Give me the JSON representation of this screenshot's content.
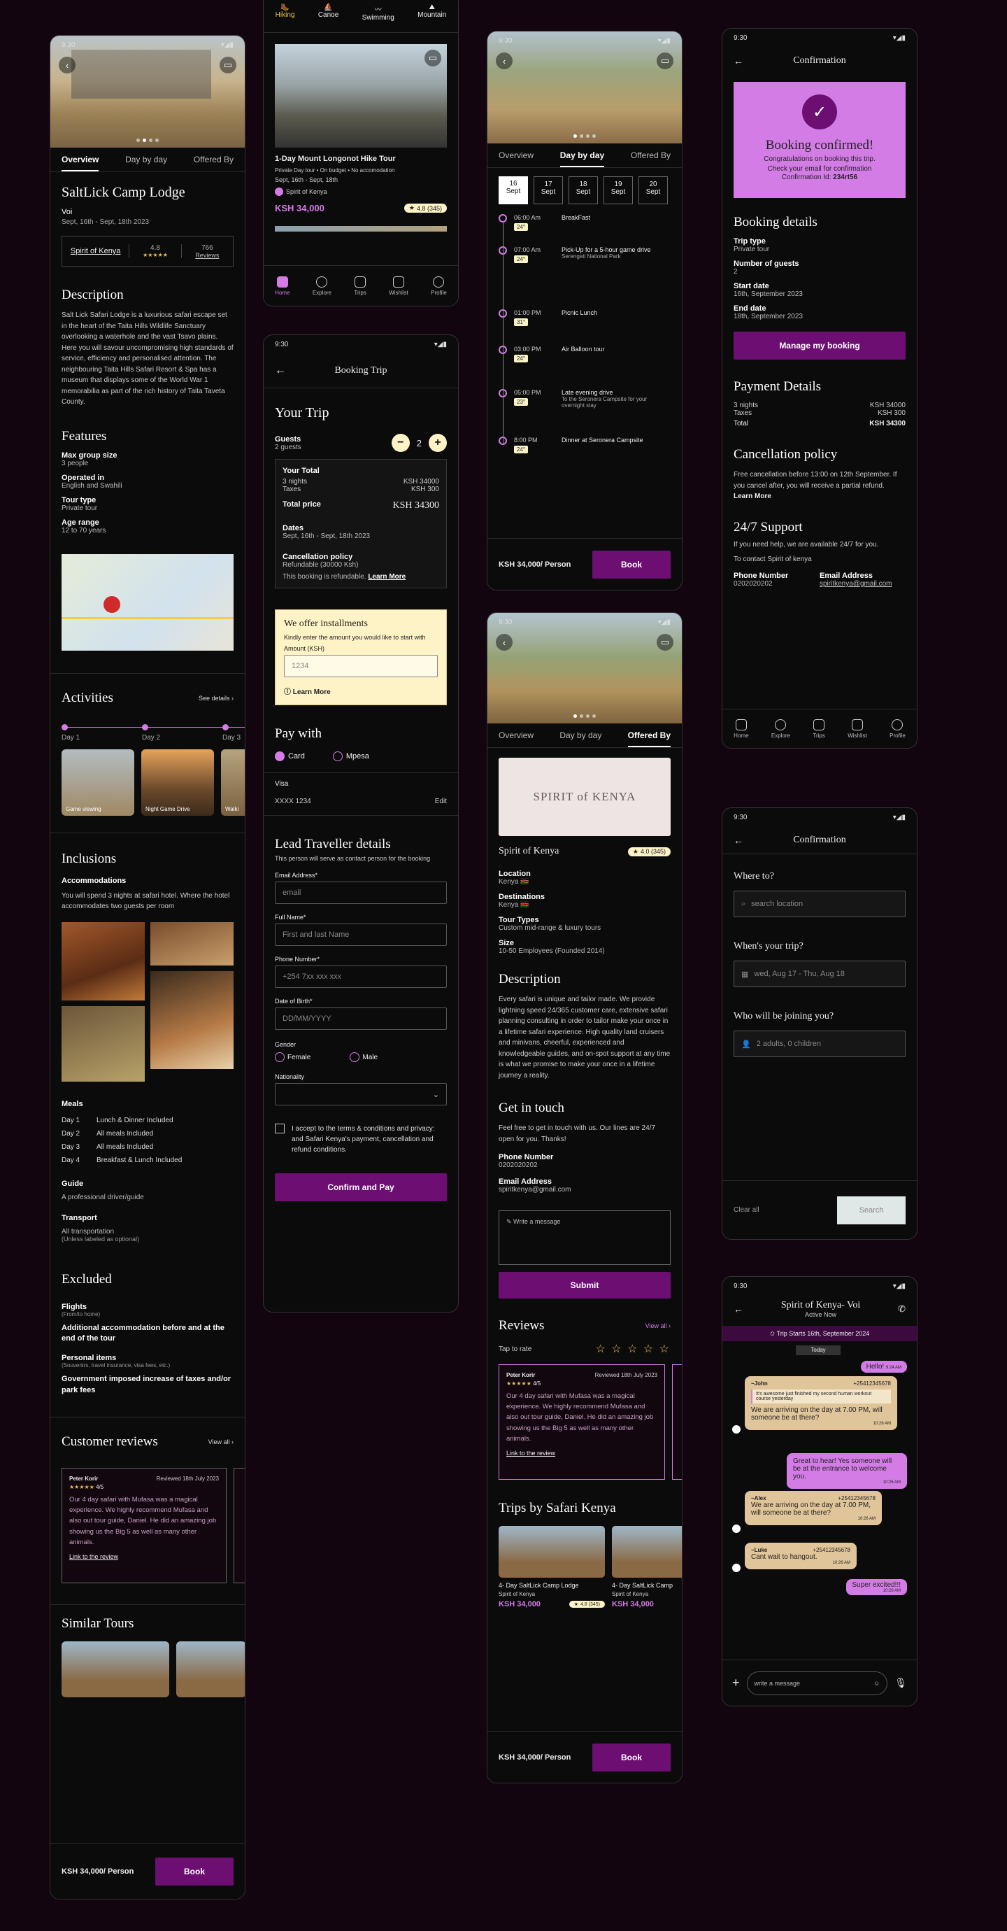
{
  "status_time": "9:30",
  "lodge": {
    "tabs": [
      "Overview",
      "Day by day",
      "Offered By"
    ],
    "title": "SaltLick Camp Lodge",
    "subtitle": "Voi",
    "dates": "Sept, 16th - Sept, 18th 2023",
    "operator": "Spirit of Kenya",
    "rating": "4.8",
    "stars": "★★★★★",
    "reviews_count": "766",
    "reviews_label": "Reviews",
    "description_title": "Description",
    "description": "Salt Lick Safari Lodge is a luxurious safari escape set in the heart of the Taita Hills Wildlife Sanctuary overlooking a waterhole and the vast Tsavo plains. Here you will savour uncompromising high standards of service, efficiency and personalised attention. The neighbouring Taita Hills Safari Resort & Spa has a museum that displays some of the World War 1 memorabilia as part of the rich history of Taita Taveta County.",
    "features_title": "Features",
    "features": [
      {
        "label": "Max group size",
        "value": "3 people"
      },
      {
        "label": "Operated in",
        "value": "English and Swahili"
      },
      {
        "label": "Tour type",
        "value": "Private tour"
      },
      {
        "label": "Age range",
        "value": "12 to 70 years"
      }
    ],
    "activities_title": "Activities",
    "see_details": "See details ›",
    "days": [
      "Day 1",
      "Day 2",
      "Day 3"
    ],
    "activities": [
      "Game viewing",
      "Night Game Drive",
      "Walki"
    ],
    "inclusions_title": "Inclusions",
    "accom_title": "Accommodations",
    "accom_text": "You will spend 3 nights at safari hotel. Where the hotel accommodates two guests per room",
    "meals_title": "Meals",
    "meals": [
      {
        "day": "Day 1",
        "text": "Lunch & Dinner Included"
      },
      {
        "day": "Day 2",
        "text": "All meals Included"
      },
      {
        "day": "Day 3",
        "text": "All meals Included"
      },
      {
        "day": "Day 4",
        "text": "Breakfast & Lunch Included"
      }
    ],
    "guide_title": "Guide",
    "guide_text": "A professional driver/guide",
    "transport_title": "Transport",
    "transport_text": "All transportation",
    "transport_note": "(Unless labeled as optional)",
    "excluded_title": "Excluded",
    "flights_title": "Flights",
    "flights_note": "(From/to home)",
    "excl1": "Additional accommodation before and at the end of the tour",
    "personal_title": "Personal items",
    "personal_note": "(Souvenirs, travel insurance, visa fees, etc.)",
    "excl2": "Government imposed increase of taxes and/or park fees",
    "cr_title": "Customer reviews",
    "view_all": "View all ›",
    "similar_title": "Similar Tours",
    "price": "KSH 34,000/ Person",
    "book": "Book"
  },
  "review": {
    "name": "Peter Korir",
    "date": "Reviewed 18th July 2023",
    "stars": "★★★★★",
    "score": "4/5",
    "text": "Our 4 day safari with Mufasa was a magical experience. We highly recommend Mufasa and also out tour guide, Daniel. He did an amazing job showing us the Big 5 as well as many other animals.",
    "link": "Link to the review"
  },
  "explore": {
    "categories": [
      "Hiking",
      "Canoe",
      "Swimming",
      "Mountain"
    ],
    "card_title": "1-Day Mount Longonot Hike Tour",
    "card_meta": "Private Day tour  •  On budget  •  No accomodation",
    "card_dates": "Sept, 16th - Sept, 18th",
    "operator": "Spirit of Kenya",
    "price": "KSH 34,000",
    "rating": "4.8 (345)",
    "nav": [
      "Home",
      "Explore",
      "Trips",
      "Wishlist",
      "Profile"
    ]
  },
  "booking": {
    "header": "Booking Trip",
    "your_trip": "Your Trip",
    "guests_label": "Guests",
    "guests_sub": "2 guests",
    "guests_count": "2",
    "total_title": "Your Total",
    "nights": "3 nights",
    "nights_val": "KSH 34000",
    "taxes": "Taxes",
    "taxes_val": "KSH 300",
    "total_price": "Total price",
    "total_val": "KSH 34300",
    "dates_label": "Dates",
    "dates_val": "Sept, 16th - Sept, 18th 2023",
    "cancel_label": "Cancellation policy",
    "cancel_val": "Refundable (30000 Ksh)",
    "refund_text": "This booking is refundable.",
    "learn_more": "Learn More",
    "inst_title": "We offer installments",
    "inst_text": "Kindly enter the amount you would like to start with",
    "amount_label": "Amount (KSH)",
    "amount_ph": "1234",
    "inst_learn": "ⓘ Learn More",
    "paywith": "Pay with",
    "card": "Card",
    "mpesa": "Mpesa",
    "visa": "Visa",
    "visa_num": "XXXX 1234",
    "edit": "Edit",
    "lead_title": "Lead Traveller details",
    "lead_sub": "This person will serve as contact person for the  booking",
    "email_label": "Email Address*",
    "email_ph": "email",
    "name_label": "Full Name*",
    "name_ph": "First and last Name",
    "phone_label": "Phone Number*",
    "phone_ph": "+254 7xx xxx xxx",
    "dob_label": "Date  of Birth*",
    "dob_ph": "DD/MM/YYYY",
    "gender_label": "Gender",
    "female": "Female",
    "male": "Male",
    "nat_label": "Nationality",
    "terms": "I accept to the terms & conditions and privacy: and Safari Kenya's payment, cancellation and refund conditions.",
    "confirm": "Confirm and Pay"
  },
  "daybyday": {
    "tabs": [
      "Overview",
      "Day by day",
      "Offered By"
    ],
    "dates": [
      {
        "d": "16",
        "m": "Sept"
      },
      {
        "d": "17",
        "m": "Sept"
      },
      {
        "d": "18",
        "m": "Sept"
      },
      {
        "d": "19",
        "m": "Sept"
      },
      {
        "d": "20",
        "m": "Sept"
      }
    ],
    "items": [
      {
        "time": "06:00 Am",
        "chip": "24°",
        "title": "BreakFast",
        "sub": ""
      },
      {
        "time": "07:00 Am",
        "chip": "24°",
        "title": "Pick-Up for a 5-hour game drive",
        "sub": "Serengeti National Park"
      },
      {
        "time": "01:00 PM",
        "chip": "31°",
        "title": "Picnic Lunch",
        "sub": ""
      },
      {
        "time": "03:00 PM",
        "chip": "24°",
        "title": "Air Balloon tour",
        "sub": ""
      },
      {
        "time": "05:00 PM",
        "chip": "23°",
        "title": "Late evening drive",
        "sub": "To the Seronera Campsite for your overnight stay"
      },
      {
        "time": "8:00 PM",
        "chip": "24°",
        "title": "Dinner at Seronera Campsite",
        "sub": ""
      }
    ],
    "price": "KSH 34,000/ Person",
    "book": "Book"
  },
  "offered": {
    "tabs": [
      "Overview",
      "Day by day",
      "Offered By"
    ],
    "logo": "SPIRIT of KENYA",
    "name": "Spirit of Kenya",
    "rating": "4.0 (345)",
    "fields": [
      {
        "label": "Location",
        "value": "Kenya 🇰🇪"
      },
      {
        "label": "Destinations",
        "value": "Kenya 🇰🇪"
      },
      {
        "label": "Tour Types",
        "value": "Custom mid-range & luxury tours"
      },
      {
        "label": "Size",
        "value": "10-50 Employees (Founded 2014)"
      }
    ],
    "desc_title": "Description",
    "desc": "Every safari is unique and tailor made. We provide lightning speed 24/365 customer care, extensive safari planning consulting in order to tailor make your once in a lifetime safari experience. High quality land cruisers and minivans, cheerful, experienced and knowledgeable guides, and on-spot support at any time is what we promise to make your once in a lifetime journey a reality.",
    "touch_title": "Get in touch",
    "touch_text": "Feel free to get in touch with us. Our lines are 24/7 open for you. Thanks!",
    "phone_label": "Phone Number",
    "phone": "0202020202",
    "email_label": "Email Address",
    "email": "spiritkenya@gmail.com",
    "msg_ph": "✎ Write a message",
    "submit": "Submit",
    "reviews_title": "Reviews",
    "view_all": "View all ›",
    "tap_rate": "Tap to rate",
    "empty_stars": "☆ ☆ ☆ ☆ ☆",
    "trips_title": "Trips by Safari Kenya",
    "trip_name": "4- Day SaltLick Camp Lodge",
    "trip_name2": "4- Day SaltLick Camp",
    "trip_op": "Spirit of Kenya",
    "trip_price": "KSH 34,000",
    "trip_rating": "4.8 (345)",
    "price": "KSH 34,000/ Person",
    "book": "Book"
  },
  "confirm": {
    "header": "Confirmation",
    "banner_title": "Booking confirmed!",
    "banner_text": "Congratulations on booking this trip. Check your email for confirmation",
    "conf_id_label": "Confirmation Id: ",
    "conf_id": "234rt56",
    "details_title": "Booking details",
    "details": [
      {
        "label": "Trip type",
        "value": "Private tour"
      },
      {
        "label": "Number of guests",
        "value": "2"
      },
      {
        "label": "Start date",
        "value": "16th, September 2023"
      },
      {
        "label": "End date",
        "value": "18th, September 2023"
      }
    ],
    "manage": "Manage my booking",
    "payment_title": "Payment Details",
    "nights": "3 nights",
    "nights_val": "KSH 34000",
    "taxes": "Taxes",
    "taxes_val": "KSH 300",
    "total": "Total",
    "total_val": "KSH 34300",
    "cancel_title": "Cancellation policy",
    "cancel_text": "Free cancellation before 13:00 on 12th September. If you cancel after, you will receive a partial refund.",
    "learn": "Learn More",
    "support_title": "24/7 Support",
    "support_text": "If you need help, we are available 24/7 for you.",
    "contact_text": "To contact Spirit of kenya",
    "phone_label": "Phone Number",
    "phone": "0202020202",
    "email_label": "Email Address",
    "email": "spiritkenya@gmail.com"
  },
  "search": {
    "header": "Confirmation",
    "where": "Where to?",
    "where_ph": "search location",
    "when": "When's your trip?",
    "when_val": "wed, Aug 17 - Thu, Aug 18",
    "who": "Who will be joining you?",
    "who_val": "2 adults, 0 children",
    "clear": "Clear all",
    "search": "Search"
  },
  "chat": {
    "title": "Spirit of Kenya- Voi",
    "status": "Active Now",
    "trip_starts": "✩  Trip Starts  16th, September 2024",
    "today": "Today",
    "msgs": {
      "hello": "Hello!",
      "hello_t": "9:24 AM",
      "john": "~John",
      "john_num": "+25412345678",
      "quote": "It's awesome just finished my second human workout course yesterday",
      "john_msg": "We are arriving on the day at 7.00 PM, will someone be at there?",
      "john_t": "10:26 AM",
      "reply": "Great to hear! Yes someone will be at the entrance to welcome you.",
      "reply_t": "10:26 AM",
      "alex": "~Alex",
      "alex_num": "+25412345678",
      "alex_msg": "We are arriving on the day at 7.00 PM, will someone be at there?",
      "alex_t": "10:26 AM",
      "luke": "~Luke",
      "luke_num": "+25412345678",
      "luke_msg": "Cant wait to hangout.",
      "luke_t": "10:26 AM",
      "super": "Super excited!!!",
      "super_t": "10:26 AM"
    },
    "input_ph": "write a message"
  }
}
